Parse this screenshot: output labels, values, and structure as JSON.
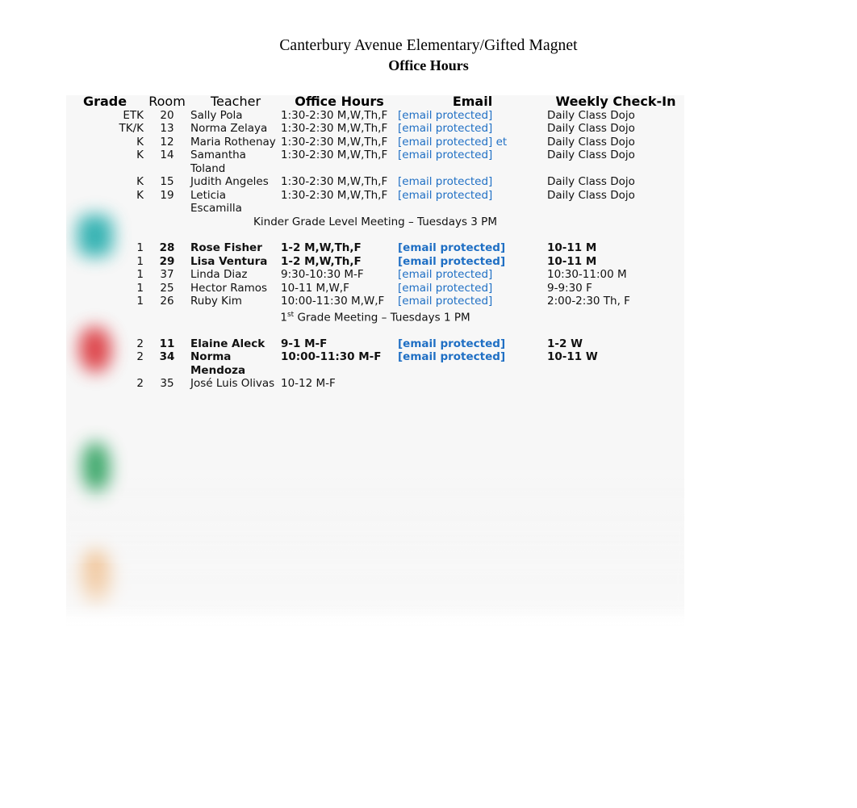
{
  "document": {
    "title_line1": "Canterbury Avenue Elementary/Gifted Magnet",
    "title_line2": "Office Hours"
  },
  "table": {
    "headers": {
      "grade": "Grade",
      "room": "Room",
      "teacher": "Teacher",
      "office_hours": "Office Hours",
      "email": "Email",
      "weekly_checkin": "Weekly Check-In"
    },
    "email_placeholder": "[email protected]",
    "email_link_color": "#1f6fc4",
    "rows": [
      {
        "grade": "ETK",
        "room": "20",
        "teacher": "Sally Pola",
        "hours": "1:30-2:30 M,W,Th,F",
        "email": "[email protected]",
        "checkin": "Daily Class Dojo",
        "bold": false
      },
      {
        "grade": "TK/K",
        "room": "13",
        "teacher": "Norma Zelaya",
        "hours": "1:30-2:30 M,W,Th,F",
        "email": "[email protected]",
        "checkin": "Daily Class Dojo",
        "bold": false
      },
      {
        "grade": "K",
        "room": "12",
        "teacher": "Maria Rothenay",
        "hours": "1:30-2:30 M,W,Th,F",
        "email": "[email protected] et",
        "checkin": "Daily Class Dojo",
        "bold": false
      },
      {
        "grade": "K",
        "room": "14",
        "teacher": "Samantha Toland",
        "hours": "1:30-2:30 M,W,Th,F",
        "email": "[email protected]",
        "checkin": "Daily Class Dojo",
        "bold": false
      },
      {
        "grade": "K",
        "room": "15",
        "teacher": "Judith Angeles",
        "hours": "1:30-2:30 M,W,Th,F",
        "email": "[email protected]",
        "checkin": "Daily Class Dojo",
        "bold": false
      },
      {
        "grade": "K",
        "room": "19",
        "teacher": "Leticia Escamilla",
        "hours": "1:30-2:30 M,W,Th,F",
        "email": "[email protected]",
        "checkin": "Daily Class Dojo",
        "bold": false
      }
    ],
    "meeting_kinder": "Kinder Grade Level Meeting – Tuesdays 3 PM",
    "rows_grade1": [
      {
        "grade": "1",
        "room": "28",
        "teacher": "Rose Fisher",
        "hours": "1-2 M,W,Th,F",
        "email": "[email protected]",
        "checkin": "10-11 M",
        "bold": true
      },
      {
        "grade": "1",
        "room": "29",
        "teacher": "Lisa Ventura",
        "hours": "1-2 M,W,Th,F",
        "email": "[email protected]",
        "checkin": "10-11 M",
        "bold": true
      },
      {
        "grade": "1",
        "room": "37",
        "teacher": "Linda Diaz",
        "hours": "9:30-10:30 M-F",
        "email": "[email protected]",
        "checkin": "10:30-11:00 M",
        "bold": false
      },
      {
        "grade": "1",
        "room": "25",
        "teacher": "Hector Ramos",
        "hours": "10-11 M,W,F",
        "email": "[email protected]",
        "checkin": "9-9:30 F",
        "bold": false
      },
      {
        "grade": "1",
        "room": "26",
        "teacher": "Ruby Kim",
        "hours": "10:00-11:30 M,W,F",
        "email": "[email protected]",
        "checkin": "2:00-2:30 Th, F",
        "bold": false
      }
    ],
    "meeting_grade1_prefix": "1",
    "meeting_grade1_sup": "st",
    "meeting_grade1_suffix": " Grade Meeting – Tuesdays 1 PM",
    "rows_grade2": [
      {
        "grade": "2",
        "room": "11",
        "teacher": "Elaine Aleck",
        "hours": "9-1 M-F",
        "email": "[email protected]",
        "checkin": "1-2 W",
        "bold": true
      },
      {
        "grade": "2",
        "room": "34",
        "teacher": "Norma Mendoza",
        "hours": "10:00-11:30 M-F",
        "email": "[email protected]",
        "checkin": "10-11 W",
        "bold": true
      },
      {
        "grade": "2",
        "room": "35",
        "teacher": "José Luis Olivas",
        "hours": "10-12 M-F",
        "email": "",
        "checkin": "",
        "bold": false
      }
    ]
  },
  "decorations": {
    "blob_teal": "#17a8a8",
    "blob_red": "#d9282f",
    "blob_green": "#1d9a52",
    "blob_orange": "#e98a2b"
  }
}
